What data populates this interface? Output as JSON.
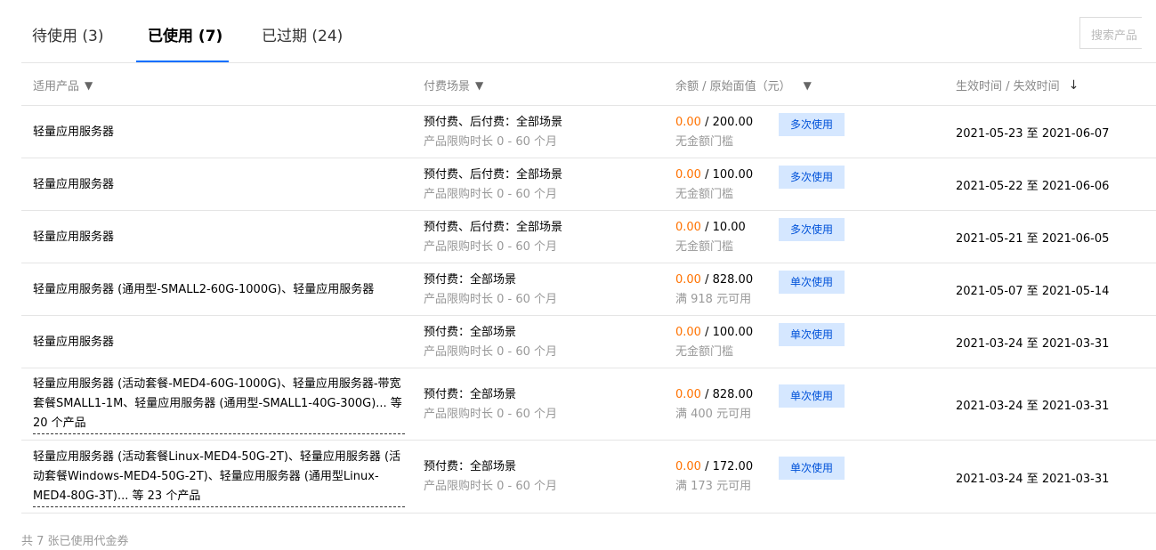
{
  "tabs": [
    {
      "label": "待使用 (3)",
      "active": false
    },
    {
      "label": "已使用 (7)",
      "active": true
    },
    {
      "label": "已过期 (24)",
      "active": false
    }
  ],
  "search": {
    "placeholder": "搜索产品"
  },
  "table": {
    "headers": {
      "product": "适用产品",
      "payment": "付费场景",
      "amount": "余额 / 原始面值（元）",
      "time": "生效时间 / 失效时间"
    },
    "rows": [
      {
        "product": "轻量应用服务器",
        "pay": "预付费、后付费：全部场景",
        "limit": "产品限购时长 0 - 60 个月",
        "used": "0.00",
        "face": " / 200.00",
        "threshold": "无金额门槛",
        "badge": "多次使用",
        "time": "2021-05-23 至 2021-06-07"
      },
      {
        "product": "轻量应用服务器",
        "pay": "预付费、后付费：全部场景",
        "limit": "产品限购时长 0 - 60 个月",
        "used": "0.00",
        "face": " / 100.00",
        "threshold": "无金额门槛",
        "badge": "多次使用",
        "time": "2021-05-22 至 2021-06-06"
      },
      {
        "product": "轻量应用服务器",
        "pay": "预付费、后付费：全部场景",
        "limit": "产品限购时长 0 - 60 个月",
        "used": "0.00",
        "face": " / 10.00",
        "threshold": "无金额门槛",
        "badge": "多次使用",
        "time": "2021-05-21 至 2021-06-05"
      },
      {
        "product": "轻量应用服务器 (通用型-SMALL2-60G-1000G)、轻量应用服务器",
        "pay": "预付费：全部场景",
        "limit": "产品限购时长 0 - 60 个月",
        "used": "0.00",
        "face": " / 828.00",
        "threshold": "满 918 元可用",
        "badge": "单次使用",
        "time": "2021-05-07 至 2021-05-14"
      },
      {
        "product": "轻量应用服务器",
        "pay": "预付费：全部场景",
        "limit": "产品限购时长 0 - 60 个月",
        "used": "0.00",
        "face": " / 100.00",
        "threshold": "无金额门槛",
        "badge": "单次使用",
        "time": "2021-03-24 至 2021-03-31"
      },
      {
        "product": "轻量应用服务器 (活动套餐-MED4-60G-1000G)、轻量应用服务器-带宽套餐SMALL1-1M、轻量应用服务器 (通用型-SMALL1-40G-300G)... 等 20 个产品",
        "pay": "预付费：全部场景",
        "limit": "产品限购时长 0 - 60 个月",
        "used": "0.00",
        "face": " / 828.00",
        "threshold": "满 400 元可用",
        "badge": "单次使用",
        "time": "2021-03-24 至 2021-03-31"
      },
      {
        "product": "轻量应用服务器 (活动套餐Linux-MED4-50G-2T)、轻量应用服务器 (活动套餐Windows-MED4-50G-2T)、轻量应用服务器 (通用型Linux-MED4-80G-3T)... 等 23 个产品",
        "pay": "预付费：全部场景",
        "limit": "产品限购时长 0 - 60 个月",
        "used": "0.00",
        "face": " / 172.00",
        "threshold": "满 173 元可用",
        "badge": "单次使用",
        "time": "2021-03-24 至 2021-03-31"
      }
    ]
  },
  "footer": {
    "text": "共 7 张已使用代金券"
  },
  "colors": {
    "accent": "#006eff",
    "used_amount": "#ff7200",
    "badge_bg": "#d5e7ff",
    "badge_text": "#0052d9"
  }
}
